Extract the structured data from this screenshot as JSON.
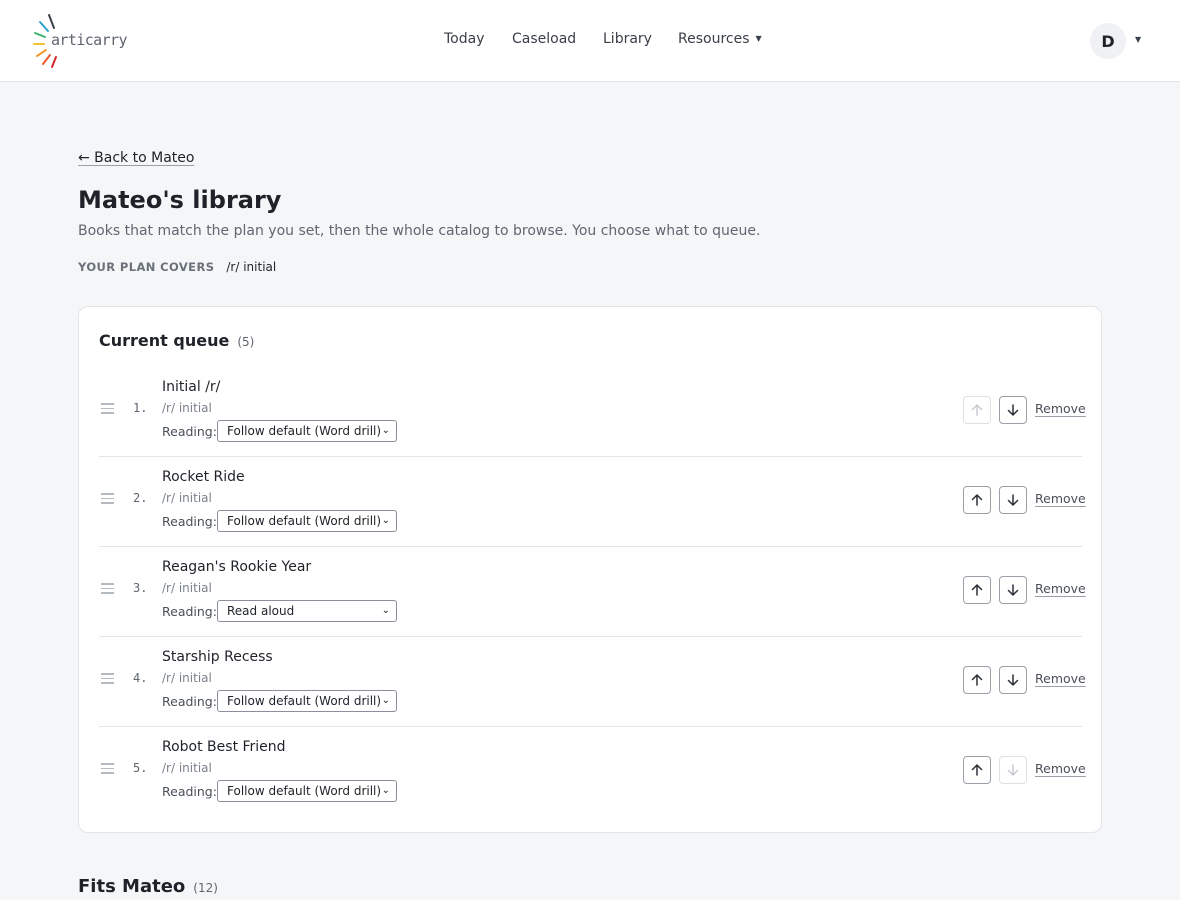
{
  "header": {
    "logo_text": "articarry",
    "nav": [
      {
        "label": "Today"
      },
      {
        "label": "Caseload"
      },
      {
        "label": "Library"
      },
      {
        "label": "Resources",
        "has_dropdown": true
      }
    ],
    "avatar_initial": "D"
  },
  "page": {
    "back_link": "← Back to Mateo",
    "title": "Mateo's library",
    "subtitle": "Books that match the plan you set, then the whole catalog to browse. You choose what to queue.",
    "plan_label": "YOUR PLAN COVERS",
    "plan_value": "/r/ initial"
  },
  "queue": {
    "title": "Current queue",
    "count": "(5)",
    "reading_label": "Reading:",
    "remove_label": "Remove",
    "items": [
      {
        "num": "1.",
        "title": "Initial /r/",
        "tag": "/r/ initial",
        "reading": "Follow default (Word drill)",
        "up_enabled": false,
        "down_enabled": true
      },
      {
        "num": "2.",
        "title": "Rocket Ride",
        "tag": "/r/ initial",
        "reading": "Follow default (Word drill)",
        "up_enabled": true,
        "down_enabled": true
      },
      {
        "num": "3.",
        "title": "Reagan's Rookie Year",
        "tag": "/r/ initial",
        "reading": "Read aloud",
        "up_enabled": true,
        "down_enabled": true
      },
      {
        "num": "4.",
        "title": "Starship Recess",
        "tag": "/r/ initial",
        "reading": "Follow default (Word drill)",
        "up_enabled": true,
        "down_enabled": true
      },
      {
        "num": "5.",
        "title": "Robot Best Friend",
        "tag": "/r/ initial",
        "reading": "Follow default (Word drill)",
        "up_enabled": true,
        "down_enabled": false
      }
    ]
  },
  "fits": {
    "title": "Fits Mateo",
    "count": "(12)"
  },
  "colors": {
    "background": "#f5f6f8",
    "card": "#ffffff",
    "text": "#1f2329",
    "muted": "#5f6670",
    "border": "#e3e5e9"
  }
}
